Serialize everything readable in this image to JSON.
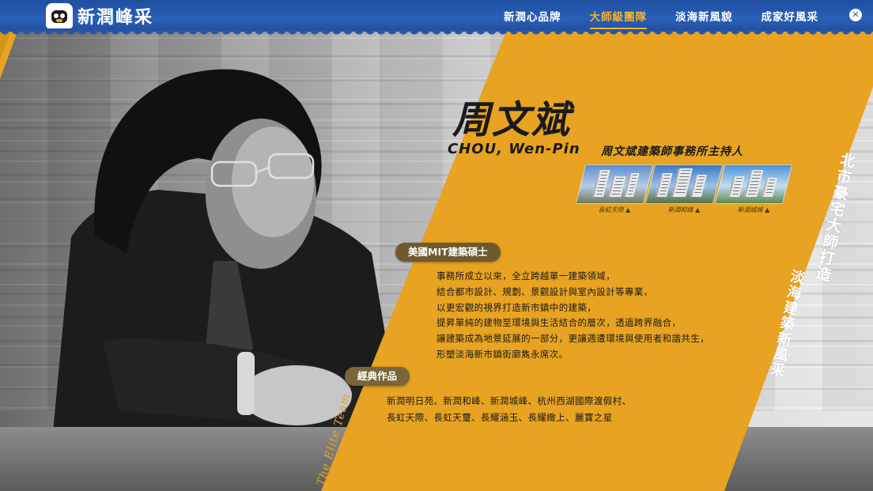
{
  "brand": {
    "logo_text": "新潤峰采",
    "logo_icon": "mascot-icon"
  },
  "nav": {
    "items": [
      {
        "label": "新潤心品牌",
        "active": false
      },
      {
        "label": "大師級團隊",
        "active": true
      },
      {
        "label": "淡海新風貌",
        "active": false
      },
      {
        "label": "成家好風采",
        "active": false
      }
    ],
    "close_icon": "close-icon",
    "close_glyph": "✕"
  },
  "colors": {
    "nav_bg": "#2a5fb8",
    "accent": "#e7a321",
    "active_nav": "#f5b526",
    "pill": "#6e5a2f"
  },
  "profile": {
    "name_cn": "周文斌",
    "name_en": "CHOU, Wen-Pin",
    "role": "周文斌建築師事務所主持人",
    "projects": [
      {
        "label": "長虹天際 ▲"
      },
      {
        "label": "新潤和峰 ▲"
      },
      {
        "label": "新潤城峰 ▲"
      }
    ],
    "degree_label": "美國MIT建築碩士",
    "bio": [
      "事務所成立以來，全立跨越單一建築領域，",
      "結合都市設計、規劃、景觀設計與室內設計等專業，",
      "以更宏觀的視界打造新市鎮中的建築，",
      "提昇單純的建物至環境與生活結合的層次，透過跨界融合，",
      "讓建築成為地景延展的一部分，更讓週遭環境與使用者和諧共生，",
      "形塑淡海新市鎮街廓雋永席次。"
    ],
    "works_label": "經典作品",
    "works": [
      "新潤明日苑、新潤和峰、新潤城峰、杭州西湖國際渡假村、",
      "長虹天際、長虹天璽、長耀涵玉、長耀緻上、麗寶之星"
    ]
  },
  "slogans": {
    "vertical_a": "北市豪宅大師打造",
    "vertical_b": "淡海建築新風采",
    "elite": "The Elite Team"
  }
}
